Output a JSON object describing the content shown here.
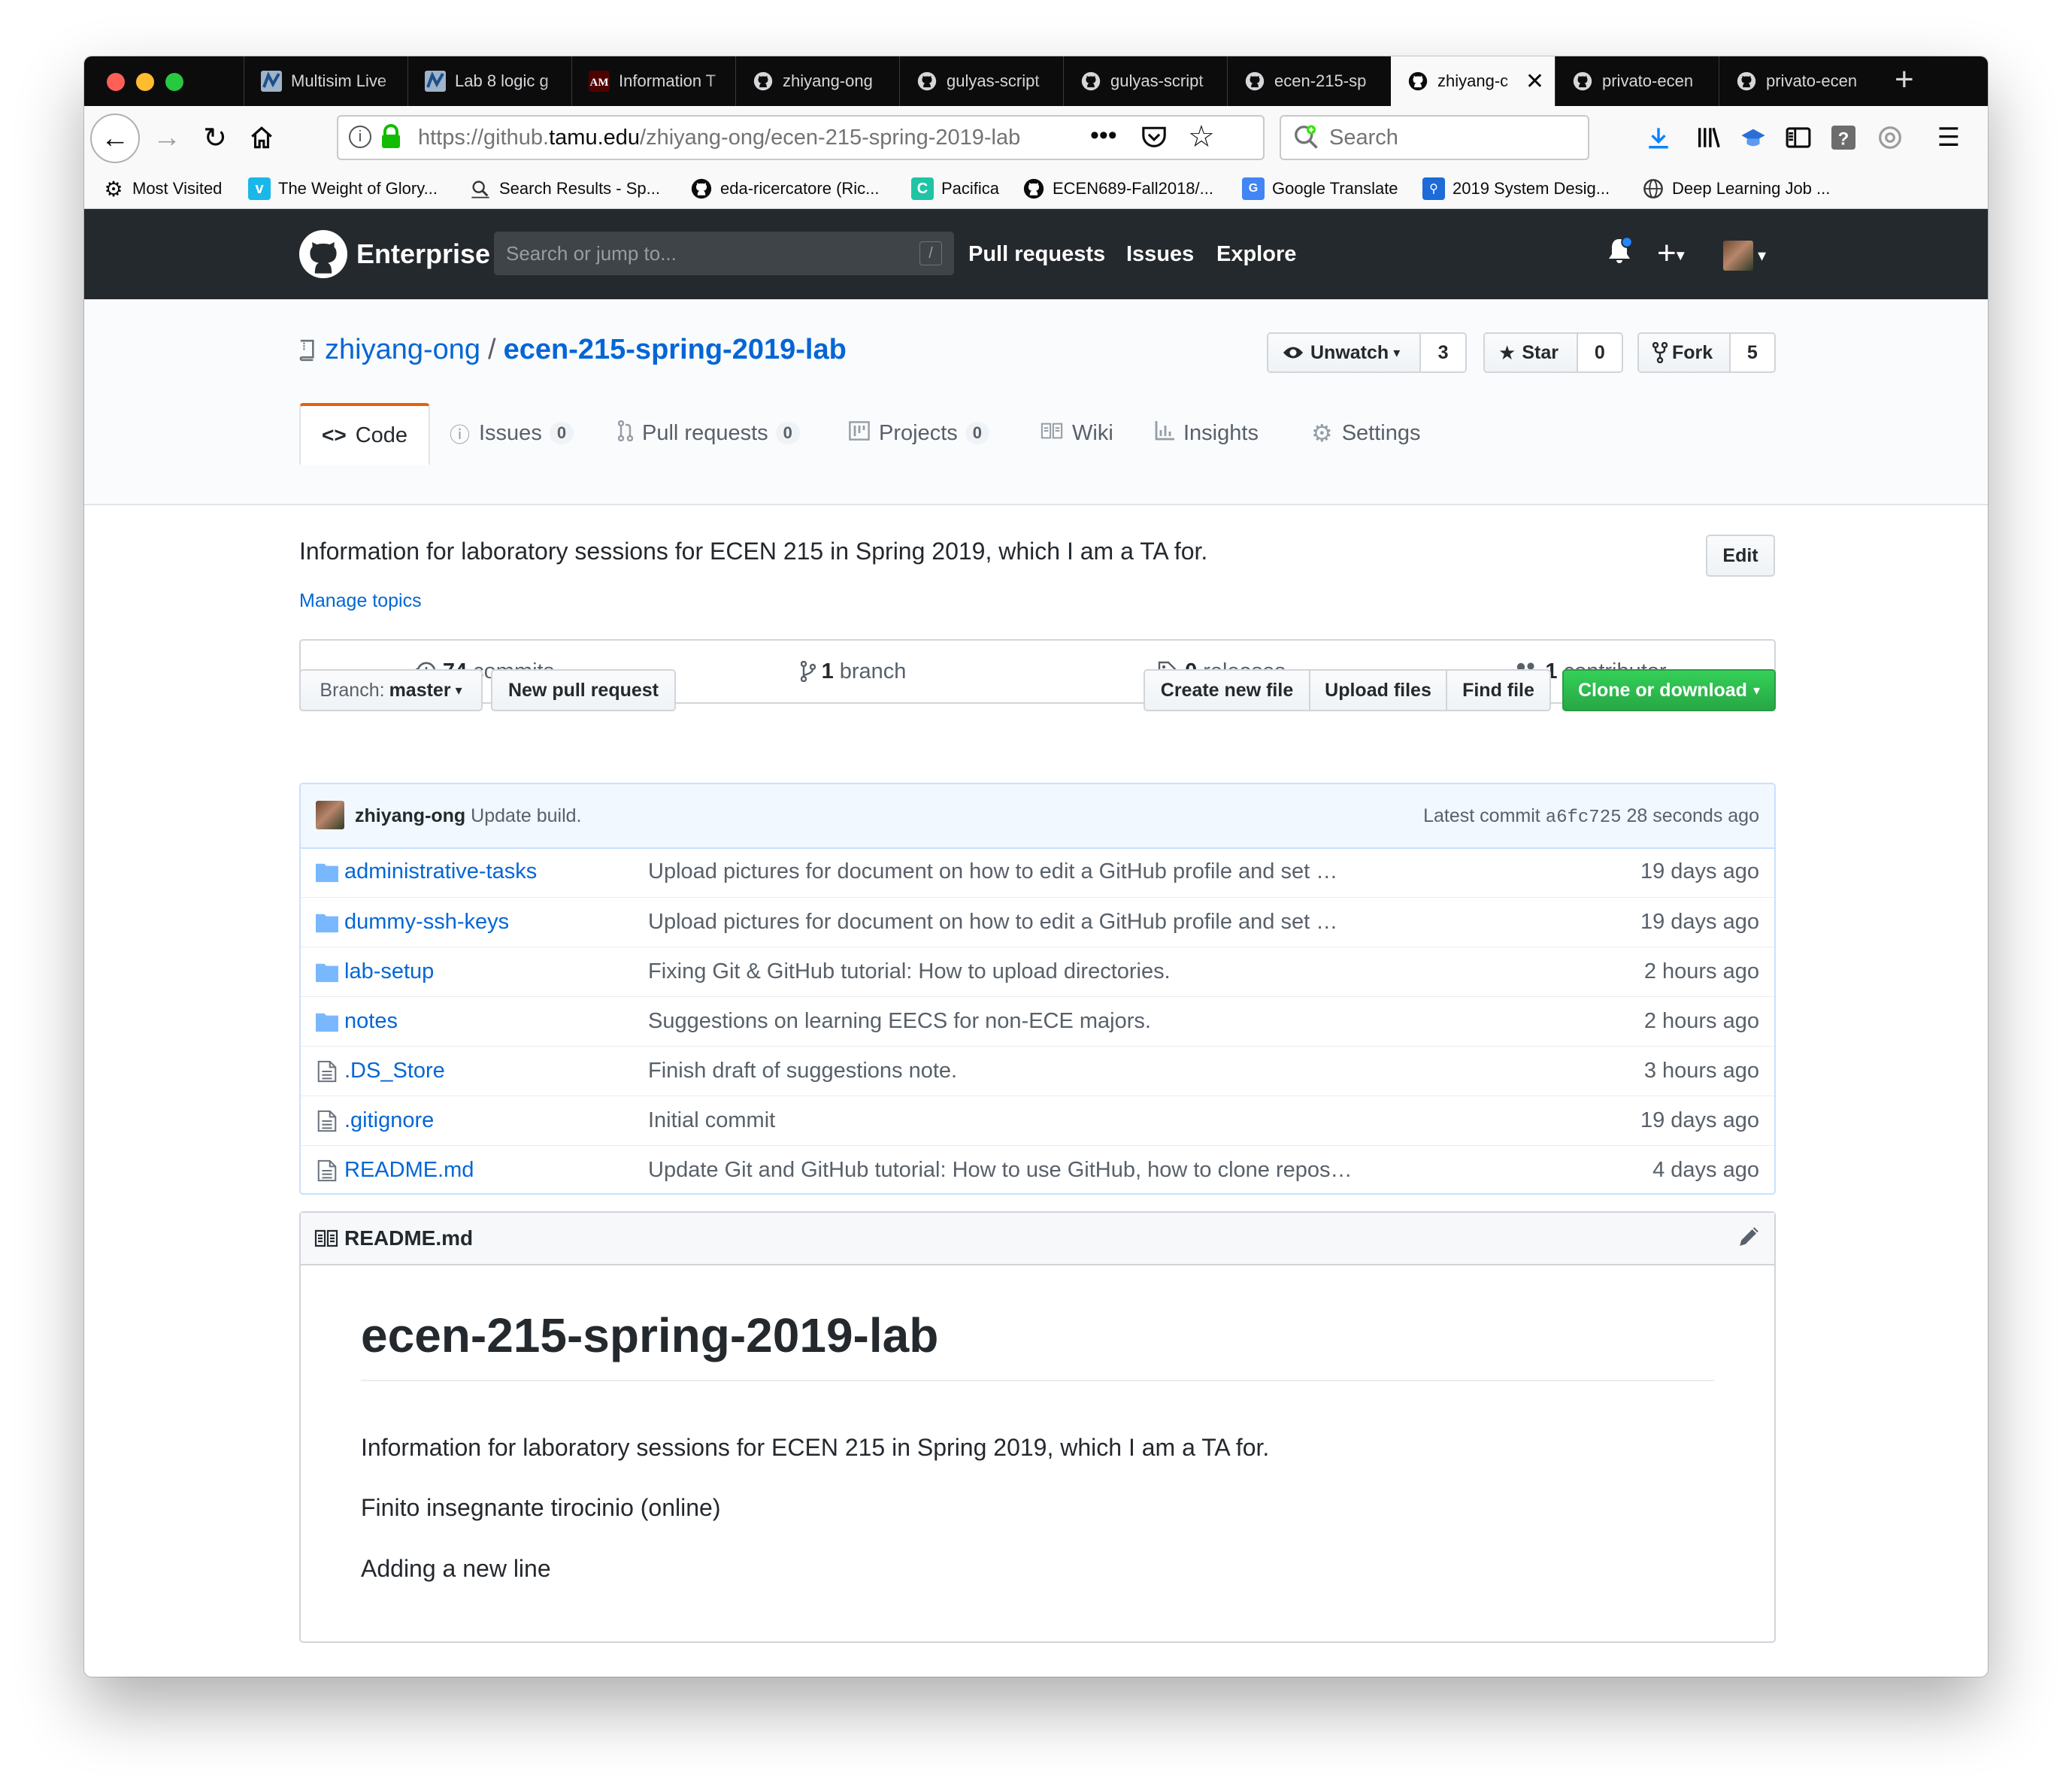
{
  "browser": {
    "tabs": [
      {
        "title": "Multisim Live",
        "icon": "multisim-icon"
      },
      {
        "title": "Lab 8 logic g",
        "icon": "multisim-icon"
      },
      {
        "title": "Information T",
        "icon": "tamu-icon"
      },
      {
        "title": "zhiyang-ong",
        "icon": "github-icon"
      },
      {
        "title": "gulyas-script",
        "icon": "github-icon"
      },
      {
        "title": "gulyas-script",
        "icon": "github-icon"
      },
      {
        "title": "ecen-215-sp",
        "icon": "github-icon"
      },
      {
        "title": "zhiyang-c",
        "icon": "github-icon",
        "active": true
      },
      {
        "title": "privato-ecen",
        "icon": "github-icon"
      },
      {
        "title": "privato-ecen",
        "icon": "github-icon"
      }
    ],
    "url_prefix": "https://github.",
    "url_host": "tamu.edu",
    "url_path": "/zhiyang-ong/ecen-215-spring-2019-lab",
    "search_placeholder": "Search",
    "bookmarks": [
      {
        "label": "Most Visited",
        "icon": "gear-icon"
      },
      {
        "label": "The Weight of Glory...",
        "icon": "vimeo-icon"
      },
      {
        "label": "Search Results - Sp...",
        "icon": "search-results-icon"
      },
      {
        "label": "eda-ricercatore (Ric...",
        "icon": "github-icon"
      },
      {
        "label": "Pacifica",
        "icon": "pacifica-icon"
      },
      {
        "label": "ECEN689-Fall2018/...",
        "icon": "github-icon"
      },
      {
        "label": "Google Translate",
        "icon": "translate-icon"
      },
      {
        "label": "2019 System Desig...",
        "icon": "conference-icon"
      },
      {
        "label": "Deep Learning Job ...",
        "icon": "globe-icon"
      }
    ]
  },
  "github": {
    "brand": "Enterprise",
    "search_placeholder": "Search or jump to...",
    "search_shortcut": "/",
    "nav": [
      "Pull requests",
      "Issues",
      "Explore"
    ]
  },
  "repo": {
    "owner": "zhiyang-ong",
    "separator": "/",
    "name": "ecen-215-spring-2019-lab",
    "actions": {
      "watch_label": "Unwatch",
      "watch_count": "3",
      "star_label": "Star",
      "star_count": "0",
      "fork_label": "Fork",
      "fork_count": "5"
    },
    "tabs": [
      {
        "label": "Code",
        "counter": ""
      },
      {
        "label": "Issues",
        "counter": "0"
      },
      {
        "label": "Pull requests",
        "counter": "0"
      },
      {
        "label": "Projects",
        "counter": "0"
      },
      {
        "label": "Wiki",
        "counter": ""
      },
      {
        "label": "Insights",
        "counter": ""
      },
      {
        "label": "Settings",
        "counter": ""
      }
    ],
    "description": "Information for laboratory sessions for ECEN 215 in Spring 2019, which I am a TA for.",
    "edit_label": "Edit",
    "manage_topics": "Manage topics",
    "summary": {
      "commits_num": "74",
      "commits_label": "commits",
      "branch_num": "1",
      "branch_label": "branch",
      "releases_num": "0",
      "releases_label": "releases",
      "contributor_num": "1",
      "contributor_label": "contributor"
    },
    "branch_prefix": "Branch:",
    "branch_name": "master",
    "new_pull_request": "New pull request",
    "create_new_file": "Create new file",
    "upload_files": "Upload files",
    "find_file": "Find file",
    "clone_or_download": "Clone or download",
    "latest_commit": {
      "author": "zhiyang-ong",
      "message": "Update build.",
      "prefix": "Latest commit",
      "sha": "a6fc725",
      "age": "28 seconds ago"
    },
    "files": [
      {
        "name": "administrative-tasks",
        "type": "dir",
        "message": "Upload pictures for document on how to edit a GitHub profile and set …",
        "age": "19 days ago"
      },
      {
        "name": "dummy-ssh-keys",
        "type": "dir",
        "message": "Upload pictures for document on how to edit a GitHub profile and set …",
        "age": "19 days ago"
      },
      {
        "name": "lab-setup",
        "type": "dir",
        "message": "Fixing Git & GitHub tutorial: How to upload directories.",
        "age": "2 hours ago"
      },
      {
        "name": "notes",
        "type": "dir",
        "message": "Suggestions on learning EECS for non-ECE majors.",
        "age": "2 hours ago"
      },
      {
        "name": ".DS_Store",
        "type": "file",
        "message": "Finish draft of suggestions note.",
        "age": "3 hours ago"
      },
      {
        "name": ".gitignore",
        "type": "file",
        "message": "Initial commit",
        "age": "19 days ago"
      },
      {
        "name": "README.md",
        "type": "file",
        "message": "Update Git and GitHub tutorial: How to use GitHub, how to clone repos…",
        "age": "4 days ago"
      }
    ],
    "readme": {
      "filename": "README.md",
      "heading": "ecen-215-spring-2019-lab",
      "paragraphs": [
        "Information for laboratory sessions for ECEN 215 in Spring 2019, which I am a TA for.",
        "Finito insegnante tirocinio (online)",
        "Adding a new line"
      ]
    }
  },
  "colors": {
    "link": "#0366d6",
    "header_dark": "#24292e",
    "clone_green": "#28a745",
    "tab_accent": "#e36209"
  }
}
